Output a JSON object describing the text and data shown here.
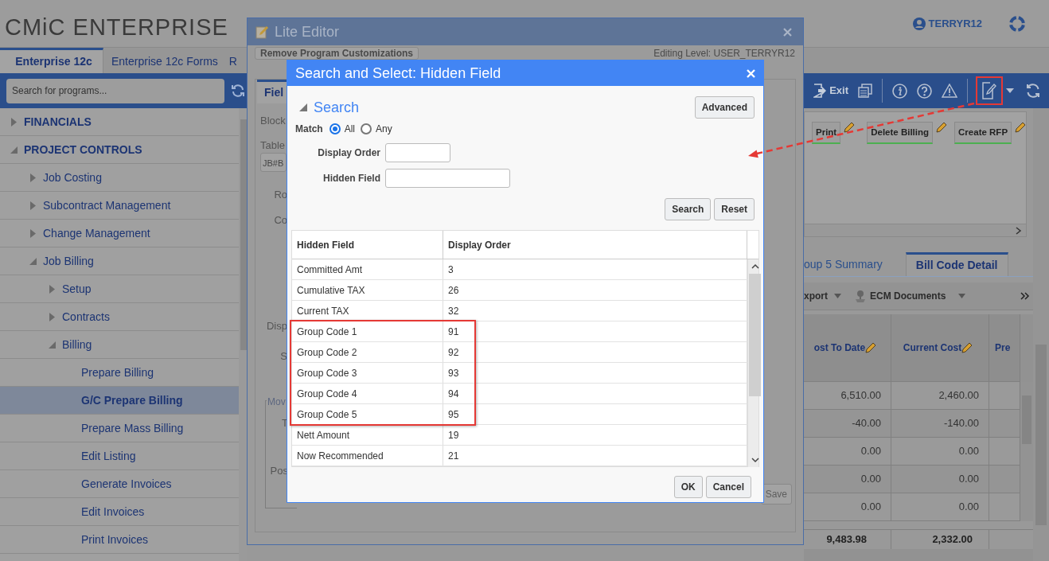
{
  "app": {
    "logo": "CMiC ENTERPRISE",
    "user": "TERRYR12"
  },
  "tabs": [
    {
      "label": "Enterprise 12c",
      "selected": true
    },
    {
      "label": "Enterprise 12c Forms",
      "selected": false
    },
    {
      "label": "R",
      "selected": false
    }
  ],
  "search": {
    "placeholder": "Search for programs..."
  },
  "toolbar": {
    "exit": "Exit",
    "edit_highlighted": true
  },
  "sidebar": {
    "items": [
      {
        "label": "FINANCIALS",
        "expanded": false
      },
      {
        "label": "PROJECT CONTROLS",
        "expanded": true,
        "children": [
          {
            "label": "Job Costing",
            "expanded": false
          },
          {
            "label": "Subcontract Management",
            "expanded": false
          },
          {
            "label": "Change Management",
            "expanded": false
          },
          {
            "label": "Job Billing",
            "expanded": true,
            "children": [
              {
                "label": "Setup",
                "expanded": false
              },
              {
                "label": "Contracts",
                "expanded": false
              },
              {
                "label": "Billing",
                "expanded": true,
                "children": [
                  {
                    "label": "Prepare Billing",
                    "selected": false
                  },
                  {
                    "label": "G/C Prepare Billing",
                    "selected": true
                  },
                  {
                    "label": "Prepare Mass Billing",
                    "selected": false
                  },
                  {
                    "label": "Edit Listing",
                    "selected": false
                  },
                  {
                    "label": "Generate Invoices",
                    "selected": false
                  },
                  {
                    "label": "Edit Invoices",
                    "selected": false
                  },
                  {
                    "label": "Print Invoices",
                    "selected": false
                  }
                ]
              }
            ]
          }
        ]
      }
    ]
  },
  "panel": {
    "buttons": [
      {
        "label": "Print"
      },
      {
        "label": "Delete Billing"
      },
      {
        "label": "Create RFP"
      }
    ]
  },
  "detail_tabs": [
    {
      "label": "oup 5 Summary",
      "selected": false
    },
    {
      "label": "Bill Code Detail",
      "selected": true
    }
  ],
  "detail_toolbar": {
    "export": "xport",
    "ecm": "ECM Documents"
  },
  "grid": {
    "columns": [
      "ost To Date",
      "Current Cost",
      "Pre"
    ],
    "rows": [
      [
        "6,510.00",
        "2,460.00"
      ],
      [
        "-40.00",
        "-140.00"
      ],
      [
        "0.00",
        "0.00"
      ],
      [
        "0.00",
        "0.00"
      ],
      [
        "0.00",
        "0.00"
      ]
    ],
    "totals": [
      "9,483.98",
      "2,332.00"
    ]
  },
  "lite_editor": {
    "title": "Lite Editor",
    "remove_button": "Remove Program Customizations",
    "editing_level": "Editing Level: USER_TERRYR12",
    "tab": "Fiel",
    "block_label": "Block",
    "table_label": "Table",
    "table_value": "JB#B",
    "labels": [
      "Ro",
      "Co",
      "Disp",
      "S"
    ],
    "group": "Mov",
    "group_labels": [
      "T",
      "Pos"
    ],
    "save": {
      "label": "Save",
      "disabled": true
    }
  },
  "dialog": {
    "title": "Search and Select: Hidden Field",
    "heading": "Search",
    "advanced": "Advanced",
    "match_label": "Match",
    "match_options": [
      {
        "label": "All",
        "selected": true
      },
      {
        "label": "Any",
        "selected": false
      }
    ],
    "fields": [
      {
        "label": "Display Order"
      },
      {
        "label": "Hidden Field"
      }
    ],
    "buttons": [
      "Search",
      "Reset"
    ],
    "columns": [
      "Hidden Field",
      "Display Order"
    ],
    "rows": [
      {
        "cells": [
          "Committed Amt",
          "3"
        ],
        "highlighted": false
      },
      {
        "cells": [
          "Cumulative TAX",
          "26"
        ],
        "highlighted": false
      },
      {
        "cells": [
          "Current TAX",
          "32"
        ],
        "highlighted": false
      },
      {
        "cells": [
          "Group Code 1",
          "91"
        ],
        "highlighted": true
      },
      {
        "cells": [
          "Group Code 2",
          "92"
        ],
        "highlighted": true
      },
      {
        "cells": [
          "Group Code 3",
          "93"
        ],
        "highlighted": true
      },
      {
        "cells": [
          "Group Code 4",
          "94"
        ],
        "highlighted": true
      },
      {
        "cells": [
          "Group Code 5",
          "95"
        ],
        "highlighted": true
      },
      {
        "cells": [
          "Nett Amount",
          "19"
        ],
        "highlighted": false
      },
      {
        "cells": [
          "Now Recommended",
          "21"
        ],
        "highlighted": false
      }
    ],
    "footer": [
      "OK",
      "Cancel"
    ]
  }
}
